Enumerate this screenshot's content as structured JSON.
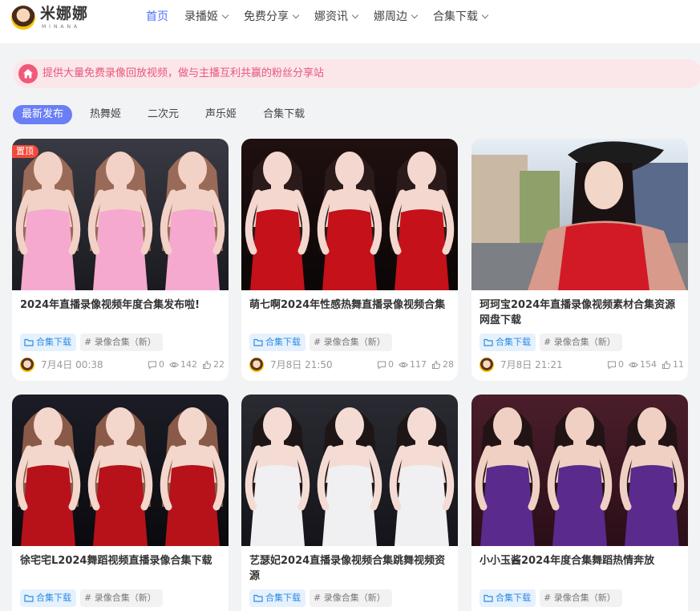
{
  "header": {
    "logo_text": "米娜娜",
    "logo_sub": "MINANA",
    "nav": [
      {
        "label": "首页",
        "active": true,
        "dropdown": false
      },
      {
        "label": "录播姬",
        "active": false,
        "dropdown": true
      },
      {
        "label": "免费分享",
        "active": false,
        "dropdown": true
      },
      {
        "label": "娜资讯",
        "active": false,
        "dropdown": true
      },
      {
        "label": "娜周边",
        "active": false,
        "dropdown": true
      },
      {
        "label": "合集下载",
        "active": false,
        "dropdown": true
      }
    ]
  },
  "notice": {
    "text": "提供大量免费录像回放视频，做与主播互利共赢的粉丝分享站",
    "icon": "home-icon"
  },
  "tabs": [
    {
      "label": "最新发布",
      "active": true
    },
    {
      "label": "热舞姬",
      "active": false
    },
    {
      "label": "二次元",
      "active": false
    },
    {
      "label": "声乐姬",
      "active": false
    },
    {
      "label": "合集下载",
      "active": false
    }
  ],
  "posts": [
    {
      "title": "2024年直播录像视频年度合集发布啦!",
      "pinned": true,
      "pin_label": "置顶",
      "category": "合集下载",
      "topic": "# 录像合集（新）",
      "date": "7月4日 00:38",
      "comments": "0",
      "views": "142",
      "likes": "22",
      "palette": "pink"
    },
    {
      "title": "萌七啊2024年性感热舞直播录像视频合集",
      "pinned": false,
      "category": "合集下载",
      "topic": "# 录像合集（新）",
      "date": "7月8日 21:50",
      "comments": "0",
      "views": "117",
      "likes": "28",
      "palette": "red"
    },
    {
      "title": "珂珂宝2024年直播录像视频素材合集资源网盘下载",
      "pinned": false,
      "category": "合集下载",
      "topic": "# 录像合集（新）",
      "date": "7月8日 21:21",
      "comments": "0",
      "views": "154",
      "likes": "11",
      "palette": "street"
    },
    {
      "title": "徐宅宅L2024舞蹈视频直播录像合集下载",
      "pinned": false,
      "category": "合集下载",
      "topic": "# 录像合集（新）",
      "palette": "redtank"
    },
    {
      "title": "艺瑟妃2024直播录像视频合集跳舞视频资源",
      "pinned": false,
      "category": "合集下载",
      "topic": "# 录像合集（新）",
      "palette": "white"
    },
    {
      "title": "小小玉酱2024年度合集舞蹈热情奔放",
      "pinned": false,
      "category": "合集下载",
      "topic": "# 录像合集（新）",
      "palette": "purple"
    }
  ],
  "colors": {
    "accent": "#4f6fff",
    "tab_active": "#6a7ef5",
    "notice_bg": "#fbe6ea",
    "notice_text": "#e9577a",
    "pin": "#f24a3a",
    "category_text": "#2e8be6"
  }
}
